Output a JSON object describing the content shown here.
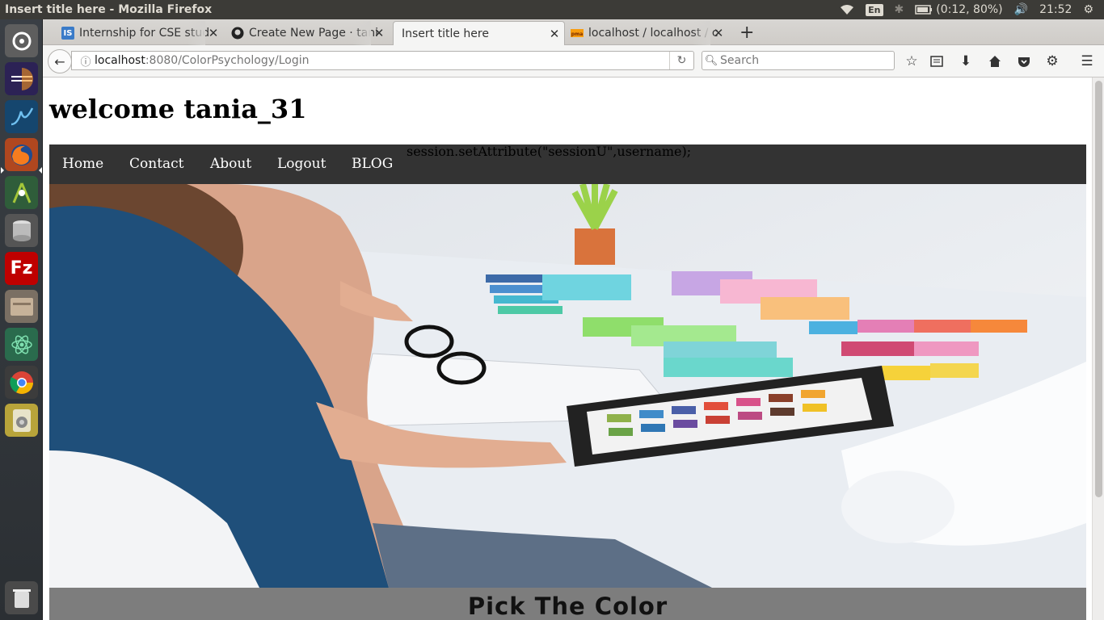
{
  "system": {
    "window_title": "Insert title here - Mozilla Firefox",
    "keyboard": "En",
    "battery": "(0:12, 80%)",
    "clock": "21:52"
  },
  "launcher": {
    "items": [
      "dash-icon",
      "eclipse-icon",
      "matlab-icon",
      "firefox-icon",
      "android-studio-icon",
      "database-icon",
      "filezilla-icon",
      "file-manager-icon",
      "atom-icon",
      "chrome-icon",
      "speaker-app-icon",
      "trash-icon"
    ]
  },
  "browser": {
    "tabs": [
      {
        "label": "Internship for CSE stud",
        "favicon": "IS"
      },
      {
        "label": "Create New Page · tani",
        "favicon": "github"
      },
      {
        "label": "Insert title here",
        "favicon": ""
      },
      {
        "label": "localhost / localhost / c",
        "favicon": "pma"
      }
    ],
    "url_host": "localhost",
    "url_path": ":8080/ColorPsychology/Login",
    "search_placeholder": "Search"
  },
  "page": {
    "welcome": "welcome tania_31",
    "menu": [
      "Home",
      "Contact",
      "About",
      "Logout",
      "BLOG"
    ],
    "session_note": "session.setAttribute(\"sessionU\",username);",
    "section_title": "Pick The Color"
  }
}
